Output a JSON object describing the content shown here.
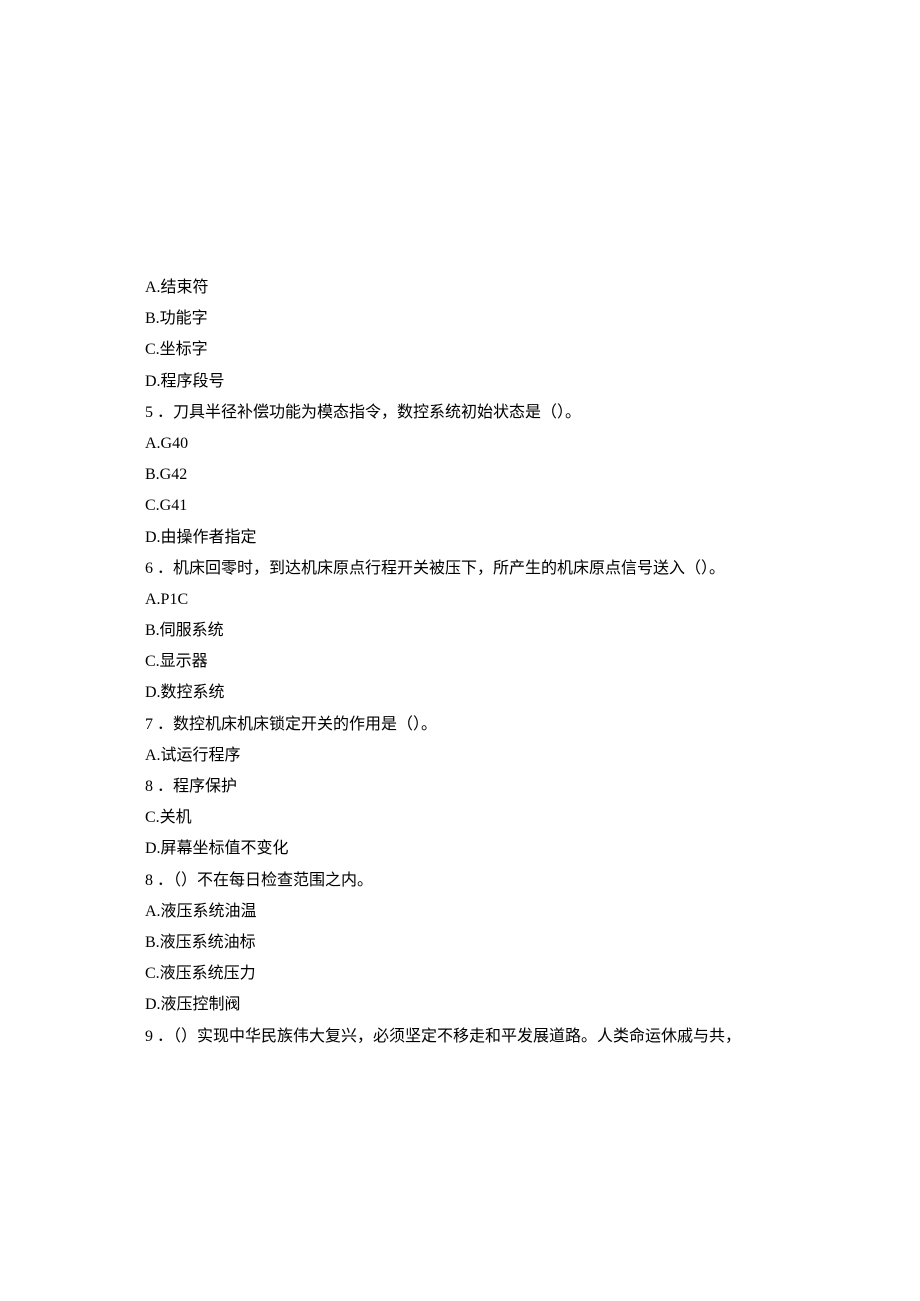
{
  "lines": [
    "A.结束符",
    "B.功能字",
    "C.坐标字",
    "D.程序段号",
    "5 ．刀具半径补偿功能为模态指令，数控系统初始状态是（）。",
    "A.G40",
    "B.G42",
    "C.G41",
    "D.由操作者指定",
    "6 ．机床回零时，到达机床原点行程开关被压下，所产生的机床原点信号送入（）。",
    "A.P1C",
    "B.伺服系统",
    "C.显示器",
    "D.数控系统",
    "7 ．数控机床机床锁定开关的作用是（）。",
    "A.试运行程序",
    "8 ．程序保护",
    "C.关机",
    "D.屏幕坐标值不变化",
    "8 ．（）不在每日检查范围之内。",
    "A.液压系统油温",
    "B.液压系统油标",
    "C.液压系统压力",
    "D.液压控制阀",
    "9 ．（）实现中华民族伟大复兴，必须坚定不移走和平发展道路。人类命运休戚与共，"
  ]
}
